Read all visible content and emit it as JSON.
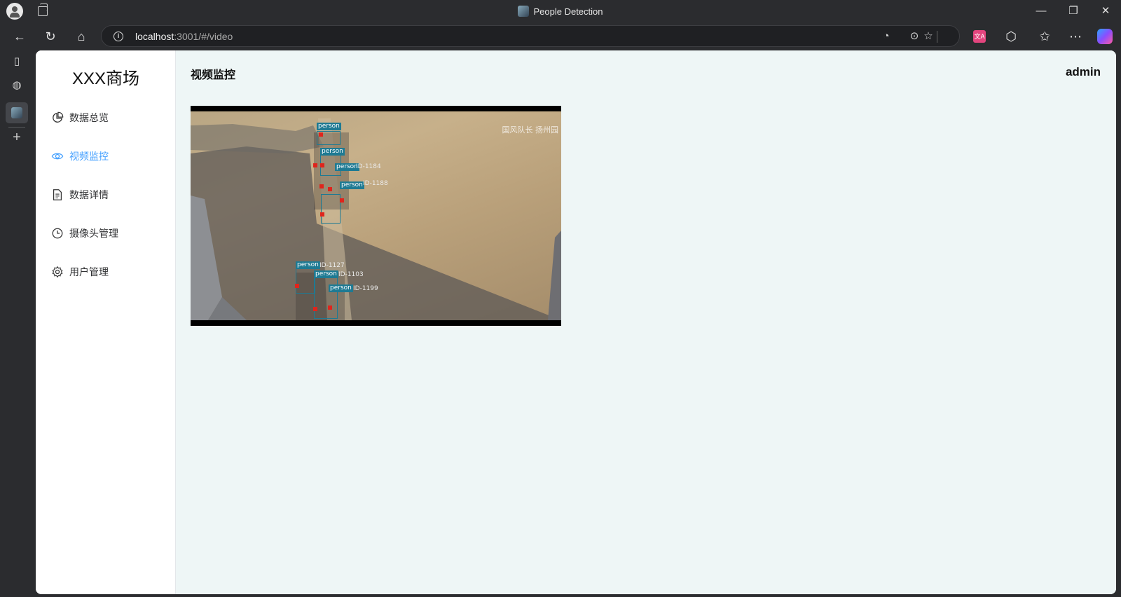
{
  "browser": {
    "window_title": "People Detection",
    "url_host": "localhost",
    "url_rest": ":3001/#/video"
  },
  "app": {
    "brand": "XXX商场",
    "page_title": "视频监控",
    "username": "admin",
    "accent_color": "#409eff",
    "menu": [
      {
        "label": "数据总览",
        "icon": "pie-chart-icon",
        "active": false
      },
      {
        "label": "视频监控",
        "icon": "eye-icon",
        "active": true
      },
      {
        "label": "数据详情",
        "icon": "document-icon",
        "active": false
      },
      {
        "label": "摄像头管理",
        "icon": "clock-icon",
        "active": false
      },
      {
        "label": "用户管理",
        "icon": "gear-icon",
        "active": false
      }
    ]
  },
  "video": {
    "watermark": "国风队长  扬州园",
    "detections": [
      {
        "label": "person",
        "id": "ID-1127"
      },
      {
        "label": "person",
        "id": "ID-1103"
      },
      {
        "label": "person",
        "id": "ID-1199"
      },
      {
        "label": "person",
        "id": "ID-1184"
      },
      {
        "label": "person",
        "id": "ID-1188"
      }
    ]
  }
}
